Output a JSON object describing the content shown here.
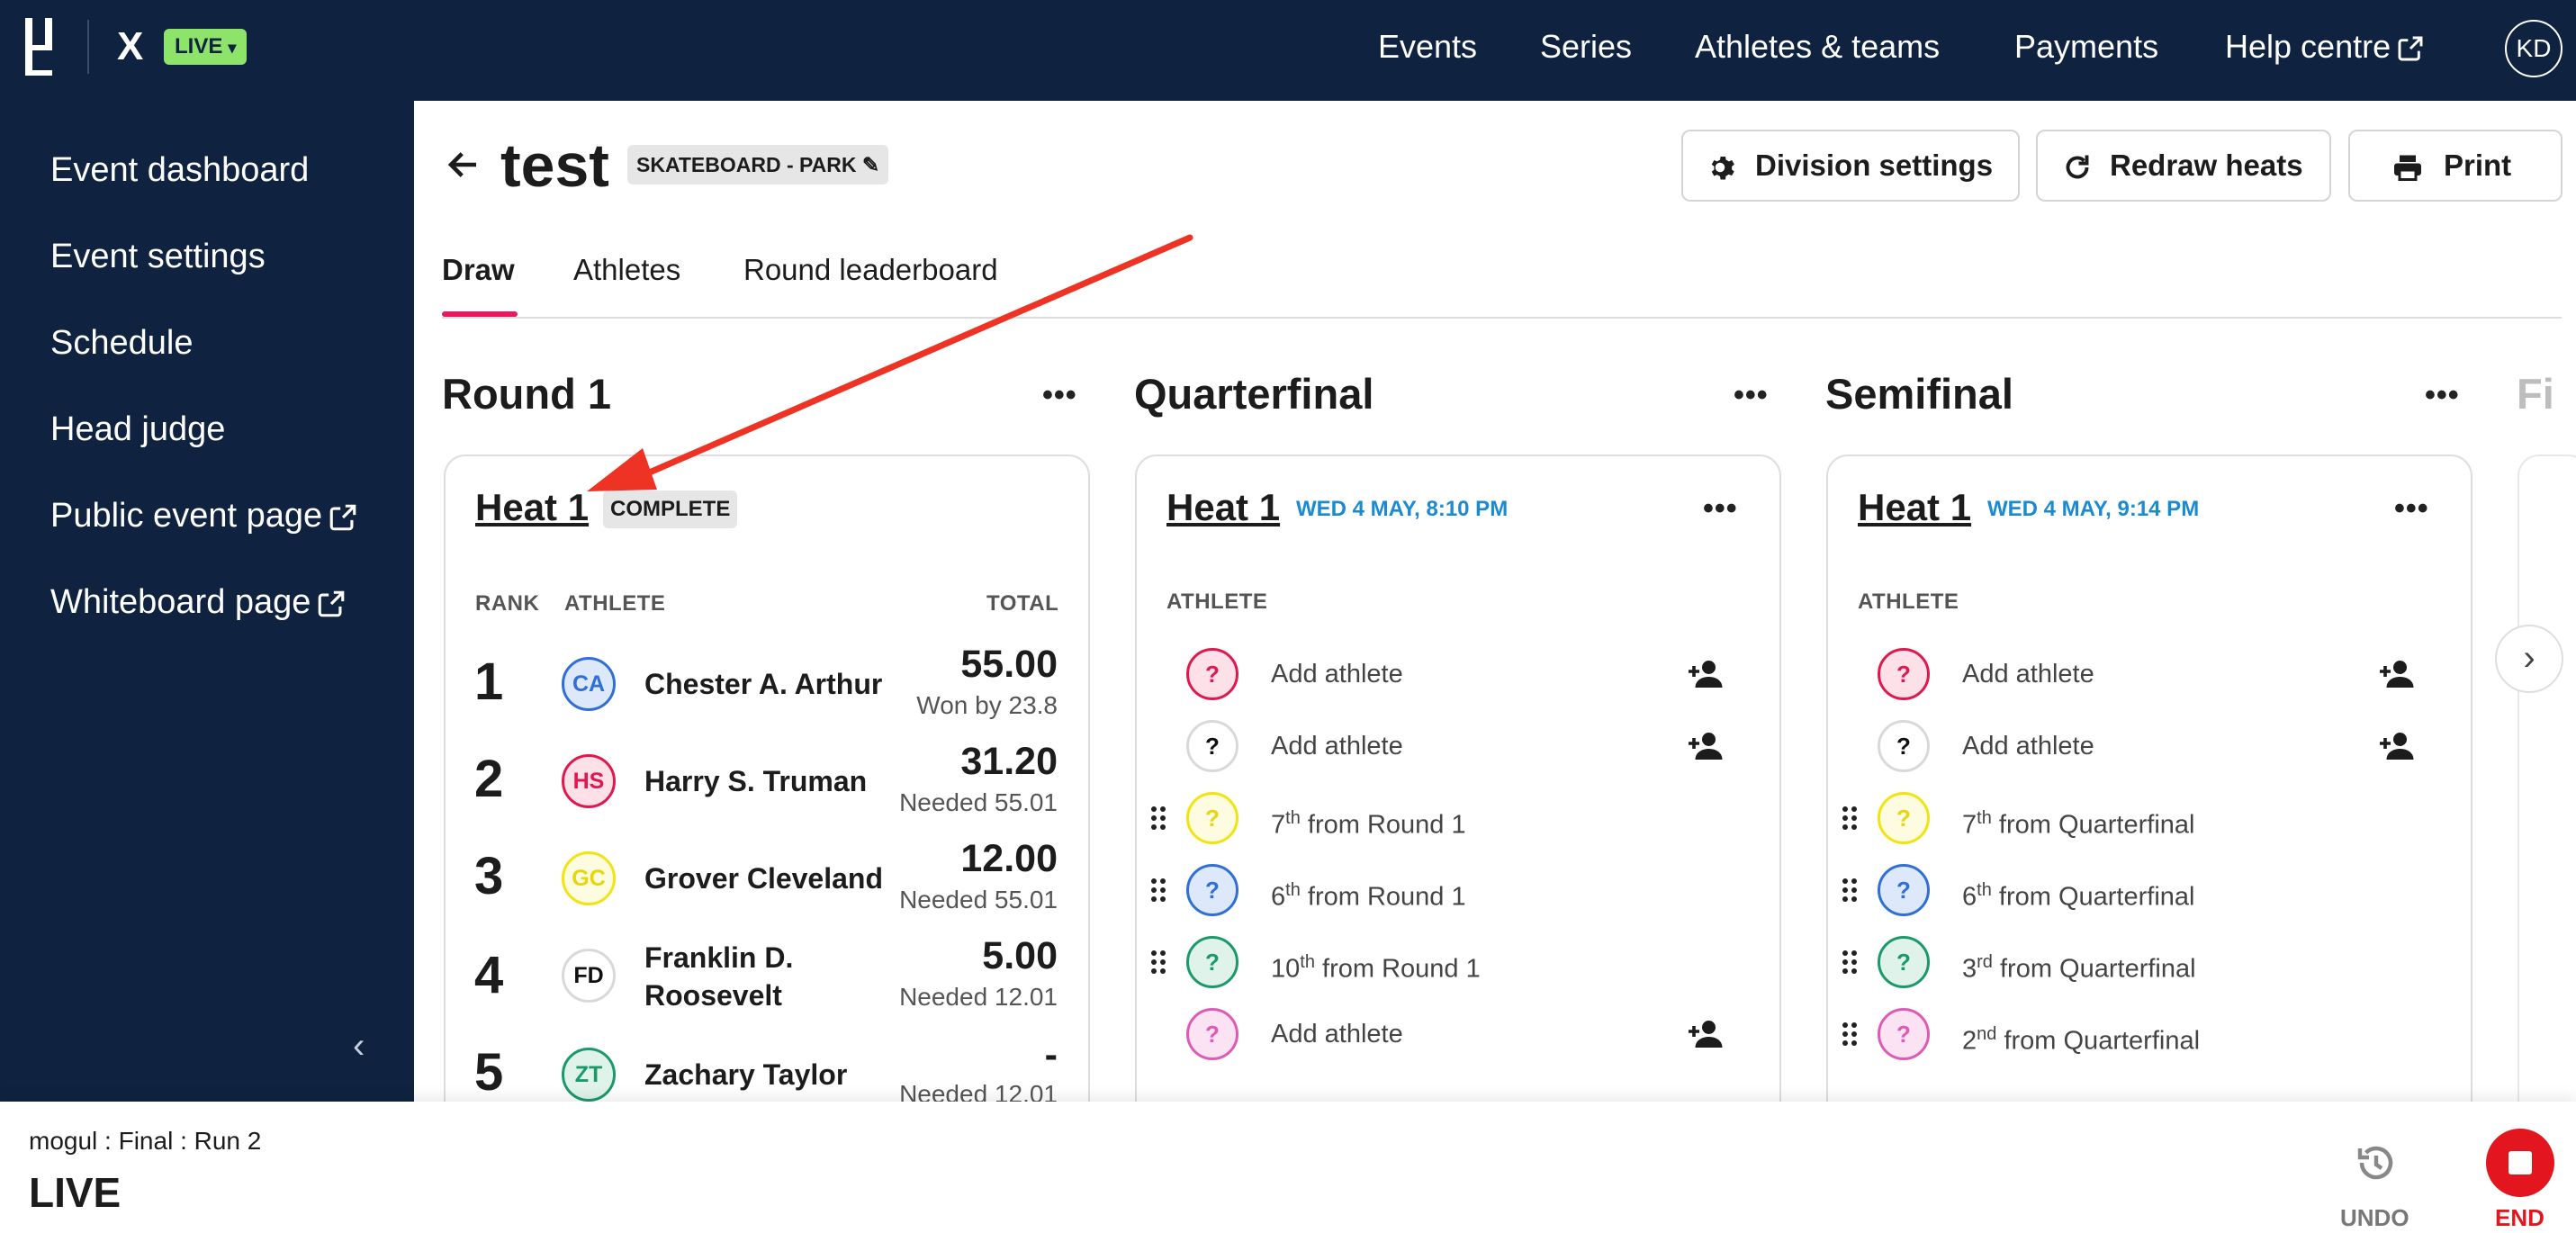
{
  "topbar": {
    "brand_mark": "X",
    "live_badge": "LIVE",
    "nav": [
      "Events",
      "Series",
      "Athletes & teams",
      "Payments",
      "Help centre"
    ],
    "avatar": "KD"
  },
  "sidebar": {
    "items": [
      {
        "label": "Event dashboard",
        "external": false
      },
      {
        "label": "Event settings",
        "external": false
      },
      {
        "label": "Schedule",
        "external": false
      },
      {
        "label": "Head judge",
        "external": false
      },
      {
        "label": "Public event page",
        "external": true
      },
      {
        "label": "Whiteboard page",
        "external": true
      }
    ]
  },
  "header": {
    "title": "test",
    "discipline": "SKATEBOARD - PARK",
    "buttons": {
      "division_settings": "Division settings",
      "redraw_heats": "Redraw heats",
      "print": "Print"
    }
  },
  "tabs": [
    {
      "label": "Draw",
      "active": true
    },
    {
      "label": "Athletes",
      "active": false
    },
    {
      "label": "Round leaderboard",
      "active": false
    }
  ],
  "round1": {
    "title": "Round 1",
    "heat": {
      "title": "Heat 1",
      "status": "COMPLETE",
      "headers": {
        "rank": "RANK",
        "athlete": "ATHLETE",
        "total": "TOTAL"
      },
      "rows": [
        {
          "rank": "1",
          "initials": "CA",
          "name": "Chester A. Arthur",
          "total": "55.00",
          "note": "Won by 23.8",
          "color": "#2f6fd6"
        },
        {
          "rank": "2",
          "initials": "HS",
          "name": "Harry S. Truman",
          "total": "31.20",
          "note": "Needed 55.01",
          "color": "#e0184f"
        },
        {
          "rank": "3",
          "initials": "GC",
          "name": "Grover Cleveland",
          "total": "12.00",
          "note": "Needed 55.01",
          "color": "#f2e312"
        },
        {
          "rank": "4",
          "initials": "FD",
          "name": "Franklin D.",
          "name2": "Roosevelt",
          "total": "5.00",
          "note": "Needed 12.01",
          "color": "#d9d9d9"
        },
        {
          "rank": "5",
          "initials": "ZT",
          "name": "Zachary Taylor",
          "total": "-",
          "note": "Needed 12.01",
          "color": "#1a9a6a"
        }
      ]
    }
  },
  "quarterfinal": {
    "title": "Quarterfinal",
    "heat": {
      "title": "Heat 1",
      "date": "WED 4 MAY, 8:10 PM",
      "header": "ATHLETE",
      "slots": [
        {
          "color": "#e0184f",
          "label": "Add athlete",
          "add": true,
          "drag": false
        },
        {
          "color": "#d9d9d9",
          "label": "Add athlete",
          "add": true,
          "drag": false
        },
        {
          "color": "#f2e312",
          "ord": "7",
          "suf": "th",
          "from": " from Round 1",
          "add": false,
          "drag": true
        },
        {
          "color": "#2f6fd6",
          "ord": "6",
          "suf": "th",
          "from": " from Round 1",
          "add": false,
          "drag": true
        },
        {
          "color": "#1a9a6a",
          "ord": "10",
          "suf": "th",
          "from": " from Round 1",
          "add": false,
          "drag": true
        },
        {
          "color": "#e05ab5",
          "label": "Add athlete",
          "add": true,
          "drag": false
        }
      ]
    }
  },
  "semifinal": {
    "title": "Semifinal",
    "heat": {
      "title": "Heat 1",
      "date": "WED 4 MAY, 9:14 PM",
      "header": "ATHLETE",
      "slots": [
        {
          "color": "#e0184f",
          "label": "Add athlete",
          "add": true,
          "drag": false
        },
        {
          "color": "#d9d9d9",
          "label": "Add athlete",
          "add": true,
          "drag": false
        },
        {
          "color": "#f2e312",
          "ord": "7",
          "suf": "th",
          "from": " from Quarterfinal",
          "add": false,
          "drag": true
        },
        {
          "color": "#2f6fd6",
          "ord": "6",
          "suf": "th",
          "from": " from Quarterfinal",
          "add": false,
          "drag": true
        },
        {
          "color": "#1a9a6a",
          "ord": "3",
          "suf": "rd",
          "from": " from Quarterfinal",
          "add": false,
          "drag": true
        },
        {
          "color": "#e05ab5",
          "ord": "2",
          "suf": "nd",
          "from": " from Quarterfinal",
          "add": false,
          "drag": true
        }
      ]
    }
  },
  "final_partial": "Fi",
  "question_mark": "?",
  "bottombar": {
    "context": "mogul : Final : Run 2",
    "status": "LIVE",
    "undo": "UNDO",
    "end": "END"
  }
}
